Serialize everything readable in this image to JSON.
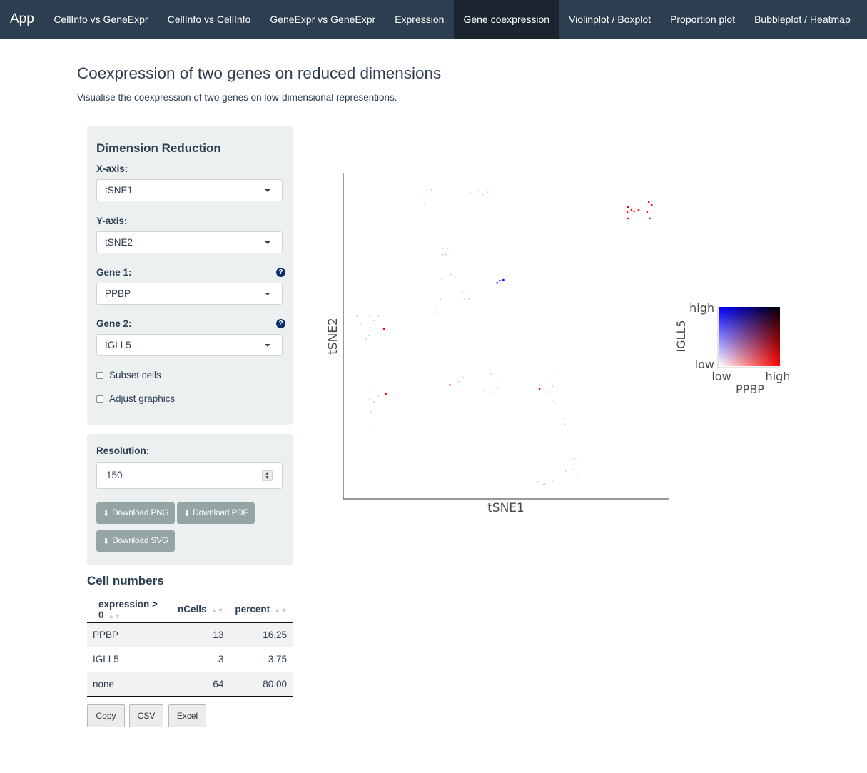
{
  "navbar": {
    "brand": "App",
    "items": [
      {
        "label": "CellInfo vs GeneExpr",
        "active": false
      },
      {
        "label": "CellInfo vs CellInfo",
        "active": false
      },
      {
        "label": "GeneExpr vs GeneExpr",
        "active": false
      },
      {
        "label": "Expression",
        "active": false
      },
      {
        "label": "Gene coexpression",
        "active": true
      },
      {
        "label": "Violinplot / Boxplot",
        "active": false
      },
      {
        "label": "Proportion plot",
        "active": false
      },
      {
        "label": "Bubbleplot / Heatmap",
        "active": false
      }
    ]
  },
  "page": {
    "title": "Coexpression of two genes on reduced dimensions",
    "subtitle": "Visualise the coexpression of two genes on low-dimensional representions."
  },
  "dimred": {
    "heading": "Dimension Reduction",
    "x_label": "X-axis:",
    "x_value": "tSNE1",
    "y_label": "Y-axis:",
    "y_value": "tSNE2",
    "gene1_label": "Gene 1:",
    "gene1_value": "PPBP",
    "gene2_label": "Gene 2:",
    "gene2_value": "IGLL5",
    "help_glyph": "?",
    "subset_label": "Subset cells",
    "subset_checked": false,
    "adjust_label": "Adjust graphics",
    "adjust_checked": false
  },
  "download": {
    "resolution_label": "Resolution:",
    "resolution_value": "150",
    "png_label": "Download PNG",
    "pdf_label": "Download PDF",
    "svg_label": "Download SVG",
    "icon": "download-icon"
  },
  "cell_numbers": {
    "title": "Cell numbers",
    "columns": [
      "expression > 0",
      "nCells",
      "percent"
    ],
    "rows": [
      [
        "PPBP",
        "13",
        "16.25"
      ],
      [
        "IGLL5",
        "3",
        "3.75"
      ],
      [
        "none",
        "64",
        "80.00"
      ]
    ],
    "buttons": [
      "Copy",
      "CSV",
      "Excel"
    ]
  },
  "chart_data": {
    "type": "scatter",
    "xlabel": "tSNE1",
    "ylabel": "tSNE2",
    "xlim": [
      0,
      100
    ],
    "ylim": [
      0,
      100
    ],
    "axis_ticks": "none",
    "grid": false,
    "legend": {
      "type": "bivariate-color",
      "position": "right",
      "x_gene": "PPBP",
      "y_gene": "IGLL5",
      "low": "low",
      "high": "high",
      "colors": {
        "none": "#d8d8d8",
        "gene1_only": "#ff0000",
        "gene2_only": "#0000ff",
        "both": "#ff00ff"
      }
    },
    "points": [
      {
        "x": 87.3,
        "y": 89.7,
        "c": "gene1"
      },
      {
        "x": 88.4,
        "y": 88.8,
        "c": "gene1"
      },
      {
        "x": 89.2,
        "y": 88.4,
        "c": "gene1"
      },
      {
        "x": 90.6,
        "y": 88.8,
        "c": "gene1"
      },
      {
        "x": 87.1,
        "y": 88.1,
        "c": "gene1"
      },
      {
        "x": 87.3,
        "y": 86.2,
        "c": "gene1"
      },
      {
        "x": 93.7,
        "y": 91.2,
        "c": "gene1"
      },
      {
        "x": 94.6,
        "y": 90.3,
        "c": "gene1"
      },
      {
        "x": 93.2,
        "y": 88.1,
        "c": "gene1"
      },
      {
        "x": 94.0,
        "y": 86.2,
        "c": "gene1"
      },
      {
        "x": 12.5,
        "y": 52.2,
        "c": "gene1"
      },
      {
        "x": 13.1,
        "y": 32.3,
        "c": "gene1"
      },
      {
        "x": 32.7,
        "y": 35.0,
        "c": "gene1"
      },
      {
        "x": 60.2,
        "y": 33.8,
        "c": "gene1"
      },
      {
        "x": 47.2,
        "y": 66.4,
        "c": "gene2"
      },
      {
        "x": 48.0,
        "y": 67.1,
        "c": "gene2"
      },
      {
        "x": 49.1,
        "y": 67.3,
        "c": "gene2"
      },
      {
        "x": 23.6,
        "y": 93.9,
        "c": "none"
      },
      {
        "x": 25.3,
        "y": 94.7,
        "c": "none"
      },
      {
        "x": 27.1,
        "y": 95.0,
        "c": "none"
      },
      {
        "x": 25.8,
        "y": 92.5,
        "c": "none"
      },
      {
        "x": 24.9,
        "y": 90.8,
        "c": "none"
      },
      {
        "x": 39.0,
        "y": 94.1,
        "c": "none"
      },
      {
        "x": 40.4,
        "y": 93.2,
        "c": "none"
      },
      {
        "x": 41.5,
        "y": 94.7,
        "c": "none"
      },
      {
        "x": 42.8,
        "y": 93.6,
        "c": "none"
      },
      {
        "x": 44.3,
        "y": 94.3,
        "c": "none"
      },
      {
        "x": 30.6,
        "y": 77.0,
        "c": "none"
      },
      {
        "x": 32.1,
        "y": 77.0,
        "c": "none"
      },
      {
        "x": 30.6,
        "y": 75.1,
        "c": "none"
      },
      {
        "x": 31.5,
        "y": 75.1,
        "c": "none"
      },
      {
        "x": 33.0,
        "y": 69.0,
        "c": "none"
      },
      {
        "x": 34.4,
        "y": 68.4,
        "c": "none"
      },
      {
        "x": 30.2,
        "y": 67.5,
        "c": "none"
      },
      {
        "x": 36.5,
        "y": 63.7,
        "c": "none"
      },
      {
        "x": 37.4,
        "y": 64.1,
        "c": "none"
      },
      {
        "x": 37.1,
        "y": 61.4,
        "c": "none"
      },
      {
        "x": 38.5,
        "y": 61.4,
        "c": "none"
      },
      {
        "x": 29.8,
        "y": 61.4,
        "c": "none"
      },
      {
        "x": 28.8,
        "y": 58.3,
        "c": "none"
      },
      {
        "x": 28.2,
        "y": 57.4,
        "c": "none"
      },
      {
        "x": 4.2,
        "y": 56.1,
        "c": "none"
      },
      {
        "x": 8.1,
        "y": 56.1,
        "c": "none"
      },
      {
        "x": 10.8,
        "y": 56.1,
        "c": "none"
      },
      {
        "x": 5.5,
        "y": 53.9,
        "c": "none"
      },
      {
        "x": 9.4,
        "y": 54.8,
        "c": "none"
      },
      {
        "x": 8.1,
        "y": 52.6,
        "c": "none"
      },
      {
        "x": 7.9,
        "y": 50.2,
        "c": "none"
      },
      {
        "x": 7.0,
        "y": 49.1,
        "c": "none"
      },
      {
        "x": 8.8,
        "y": 33.6,
        "c": "none"
      },
      {
        "x": 10.8,
        "y": 31.6,
        "c": "none"
      },
      {
        "x": 8.1,
        "y": 30.7,
        "c": "none"
      },
      {
        "x": 9.4,
        "y": 29.8,
        "c": "none"
      },
      {
        "x": 8.5,
        "y": 26.8,
        "c": "none"
      },
      {
        "x": 9.6,
        "y": 25.9,
        "c": "none"
      },
      {
        "x": 8.3,
        "y": 22.8,
        "c": "none"
      },
      {
        "x": 35.5,
        "y": 36.0,
        "c": "none"
      },
      {
        "x": 36.8,
        "y": 37.3,
        "c": "none"
      },
      {
        "x": 45.4,
        "y": 38.4,
        "c": "none"
      },
      {
        "x": 47.2,
        "y": 37.1,
        "c": "none"
      },
      {
        "x": 45.0,
        "y": 34.2,
        "c": "none"
      },
      {
        "x": 47.4,
        "y": 34.0,
        "c": "none"
      },
      {
        "x": 43.2,
        "y": 33.3,
        "c": "none"
      },
      {
        "x": 46.3,
        "y": 32.5,
        "c": "none"
      },
      {
        "x": 64.6,
        "y": 38.6,
        "c": "none"
      },
      {
        "x": 63.1,
        "y": 35.7,
        "c": "none"
      },
      {
        "x": 64.2,
        "y": 34.6,
        "c": "none"
      },
      {
        "x": 62.4,
        "y": 32.9,
        "c": "none"
      },
      {
        "x": 64.2,
        "y": 30.3,
        "c": "none"
      },
      {
        "x": 64.8,
        "y": 29.4,
        "c": "none"
      },
      {
        "x": 67.6,
        "y": 24.6,
        "c": "none"
      },
      {
        "x": 68.1,
        "y": 22.8,
        "c": "none"
      },
      {
        "x": 71.2,
        "y": 12.5,
        "c": "none"
      },
      {
        "x": 70.1,
        "y": 12.3,
        "c": "none"
      },
      {
        "x": 72.2,
        "y": 12.1,
        "c": "none"
      },
      {
        "x": 70.3,
        "y": 9.1,
        "c": "none"
      },
      {
        "x": 68.3,
        "y": 8.6,
        "c": "none"
      },
      {
        "x": 71.5,
        "y": 6.4,
        "c": "none"
      },
      {
        "x": 64.2,
        "y": 5.7,
        "c": "none"
      },
      {
        "x": 61.8,
        "y": 4.6,
        "c": "none"
      },
      {
        "x": 59.9,
        "y": 5.3,
        "c": "none"
      },
      {
        "x": 61.3,
        "y": 4.4,
        "c": "none"
      }
    ]
  }
}
